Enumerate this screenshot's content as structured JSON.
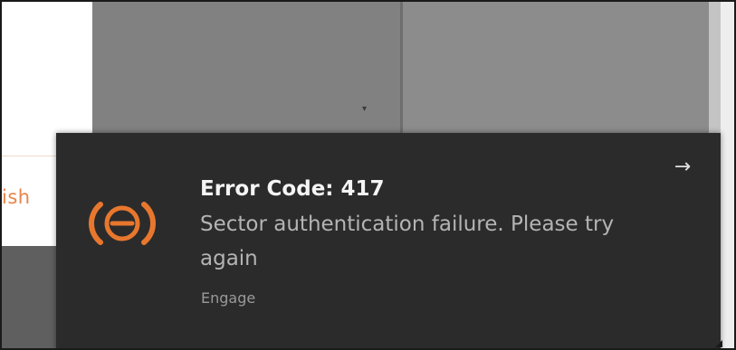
{
  "background": {
    "partial_label": "ish",
    "dropdown_caret": "▾"
  },
  "notification": {
    "title": "Error Code: 417",
    "body": "Sector authentication failure. Please try again",
    "source": "Engage",
    "arrow_icon": "→",
    "app_icon": "engage-logo-icon"
  },
  "colors": {
    "toast_bg": "#2b2b2b",
    "accent": "#e8772e",
    "title_text": "#f5f5f5",
    "body_text": "#b4b4b4",
    "source_text": "#9a9a9a"
  }
}
